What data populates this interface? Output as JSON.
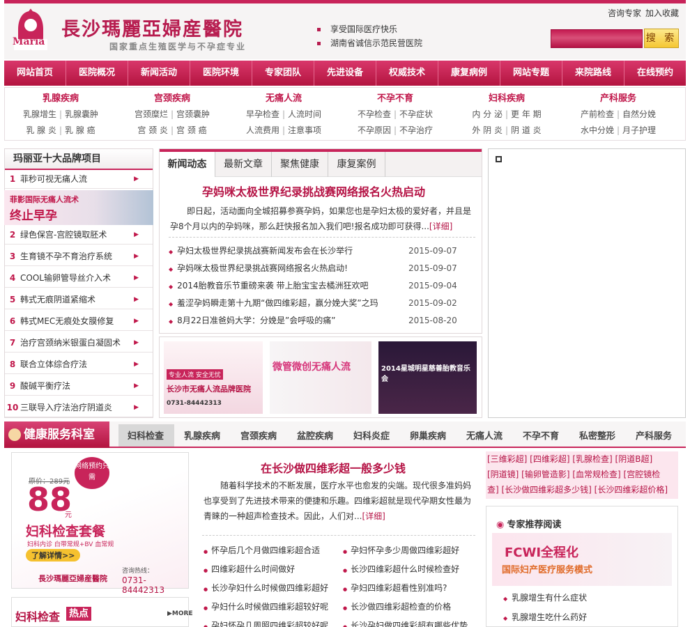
{
  "header": {
    "site_name": "長沙瑪麗亞婦産醫院",
    "slogan": "国家重点生殖医学与不孕症专业",
    "highlight1": "享受国际医疗快乐",
    "highlight2": "湖南省诚信示范民营医院",
    "link_consult": "咨询专家",
    "link_favorite": "加入收藏",
    "search_button": "搜 索",
    "logo_text": "Maria"
  },
  "nav": [
    "网站首页",
    "医院概况",
    "新闻活动",
    "医院环境",
    "专家团队",
    "先进设备",
    "权威技术",
    "康复病例",
    "网站专题",
    "来院路线",
    "在线预约"
  ],
  "categories": [
    {
      "title": "乳腺疾病",
      "r1": [
        "乳腺增生",
        "乳腺囊肿"
      ],
      "r2": [
        "乳 腺 炎",
        "乳 腺 癌"
      ]
    },
    {
      "title": "宫颈疾病",
      "r1": [
        "宫颈糜烂",
        "宫颈囊肿"
      ],
      "r2": [
        "宫 颈 炎",
        "宫 颈 癌"
      ]
    },
    {
      "title": "无痛人流",
      "r1": [
        "早孕检查",
        "人流时间"
      ],
      "r2": [
        "人流费用",
        "注意事项"
      ]
    },
    {
      "title": "不孕不育",
      "r1": [
        "不孕检查",
        "不孕症状"
      ],
      "r2": [
        "不孕原因",
        "不孕治疗"
      ]
    },
    {
      "title": "妇科疾病",
      "r1": [
        "内 分 泌",
        "更 年 期"
      ],
      "r2": [
        "外 阴 炎",
        "阴 道 炎"
      ]
    },
    {
      "title": "产科服务",
      "r1": [
        "产前检查",
        "自然分娩"
      ],
      "r2": [
        "水中分娩",
        "月子护理"
      ]
    }
  ],
  "brand": {
    "title": "玛丽亚十大品牌项目",
    "promo_line1": "菲影国际无痛人流术",
    "promo_line2": "终止早孕",
    "items": [
      {
        "num": "1",
        "text": "菲秒可视无痛人流"
      },
      {
        "num": "2",
        "text": "绿色保宫-宫腔镜取胚术"
      },
      {
        "num": "3",
        "text": "生育镜不孕不育治疗系统"
      },
      {
        "num": "4",
        "text": "COOL输卵管导丝介入术"
      },
      {
        "num": "5",
        "text": "韩式无痕阴道紧缩术"
      },
      {
        "num": "6",
        "text": "韩式MEC无痕处女膜修复"
      },
      {
        "num": "7",
        "text": "治疗宫颈纳米银蛋白凝固术"
      },
      {
        "num": "8",
        "text": "联合立体综合疗法"
      },
      {
        "num": "9",
        "text": "酸碱平衡疗法"
      },
      {
        "num": "10",
        "text": "三联导入疗法治疗阴道炎"
      }
    ]
  },
  "news": {
    "tabs": [
      "新闻动态",
      "最新文章",
      "聚焦健康",
      "康复案例"
    ],
    "headline": "孕妈咪太极世界纪录挑战赛网络报名火热启动",
    "summary": "即日起，活动面向全城招募参赛孕妈，如果您也是孕妇太极的爱好者，并且是孕8个月以内的孕妈咪，那么赶快报名加入我们吧!报名成功即可获得...",
    "more": "[详细]",
    "items": [
      {
        "title": "孕妇太极世界纪录挑战赛新闻发布会在长沙举行",
        "date": "2015-09-07"
      },
      {
        "title": "孕妈咪太极世界纪录挑战赛网络报名火热启动!",
        "date": "2015-09-07"
      },
      {
        "title": "2014胎教音乐节重磅来袭 带上胎宝宝去橘洲狂欢吧",
        "date": "2015-09-04"
      },
      {
        "title": "羞涩孕妈瞬走第十九期“做四维彩超，赢分娩大奖”之玛",
        "date": "2015-09-02"
      },
      {
        "title": "8月22日准爸妈大学：分娩是”会呼吸的痛”",
        "date": "2015-08-20"
      }
    ],
    "pic1_tag": "专业人流 安全无忧",
    "pic1_text": "长沙市无痛人流品牌医院",
    "pic1_phone": "0731-84442313",
    "pic2_text": "微管微创无痛人流",
    "pic3_text": "2014星城明星慈善胎教音乐会"
  },
  "health": {
    "title": "健康服务科室",
    "tabs": [
      "妇科检查",
      "乳腺疾病",
      "宫颈疾病",
      "盆腔疾病",
      "妇科炎症",
      "卵巢疾病",
      "无痛人流",
      "不孕不育",
      "私密整形",
      "产科服务"
    ]
  },
  "promo2": {
    "badge": "网络预约只需",
    "orig_price": "原价：289元",
    "price": "88",
    "yuan": "元",
    "pkg": "妇科检查套餐",
    "pkg_sub": "妇科内诊 白带常规+BV 血常规",
    "btn": "了解详情>>",
    "hospital": "長沙瑪麗亞婦産醫院",
    "hotline_label": "咨询热线：",
    "hotline": "0731-84442313"
  },
  "check": {
    "title": "妇科检查",
    "hot": "热点",
    "more": "MORE"
  },
  "article": {
    "title": "在长沙做四维彩超一般多少钱",
    "summary": "随着科学技术的不断发展，医疗水平也愈发的尖端。现代很多准妈妈也享受到了先进技术带来的便捷和乐趣。四维彩超就是现代孕期女性最为青睐的一种超声检查技术。因此，人们对...",
    "more": "[详细]",
    "left": [
      "怀孕后几个月做四维彩超合适",
      "四维彩超什么时间做好",
      "长沙孕妇什么时候做四维彩超好",
      "孕妇什么时候做四维彩超较好呢",
      "孕妇怀孕几周照四维彩超较好呢"
    ],
    "right": [
      "孕妇怀孕多少周做四维彩超好",
      "长沙四维彩超什么时候检查好",
      "孕妇四维彩超看性别准吗?",
      "长沙做四维彩超检查的价格",
      "长沙孕妇做四维彩超有哪些优势"
    ]
  },
  "tags": {
    "line1": "[三维彩超] [四维彩超] [乳腺检查] [阴道B超]",
    "line2": "[阴道镜] [输卵管造影] [血常规检查] [宫腔镜检",
    "line3": "查] [长沙做四维彩超多少钱] [长沙四维彩超价格]"
  },
  "expert": {
    "title": "专家推荐阅读",
    "banner1": "FCWI全程化",
    "banner2": "国际妇产医疗服务模式",
    "items": [
      "乳腺增生有什么症状",
      "乳腺增生吃什么药好"
    ]
  },
  "colors": {
    "brand": "#c8245a",
    "dark": "#b51345"
  }
}
